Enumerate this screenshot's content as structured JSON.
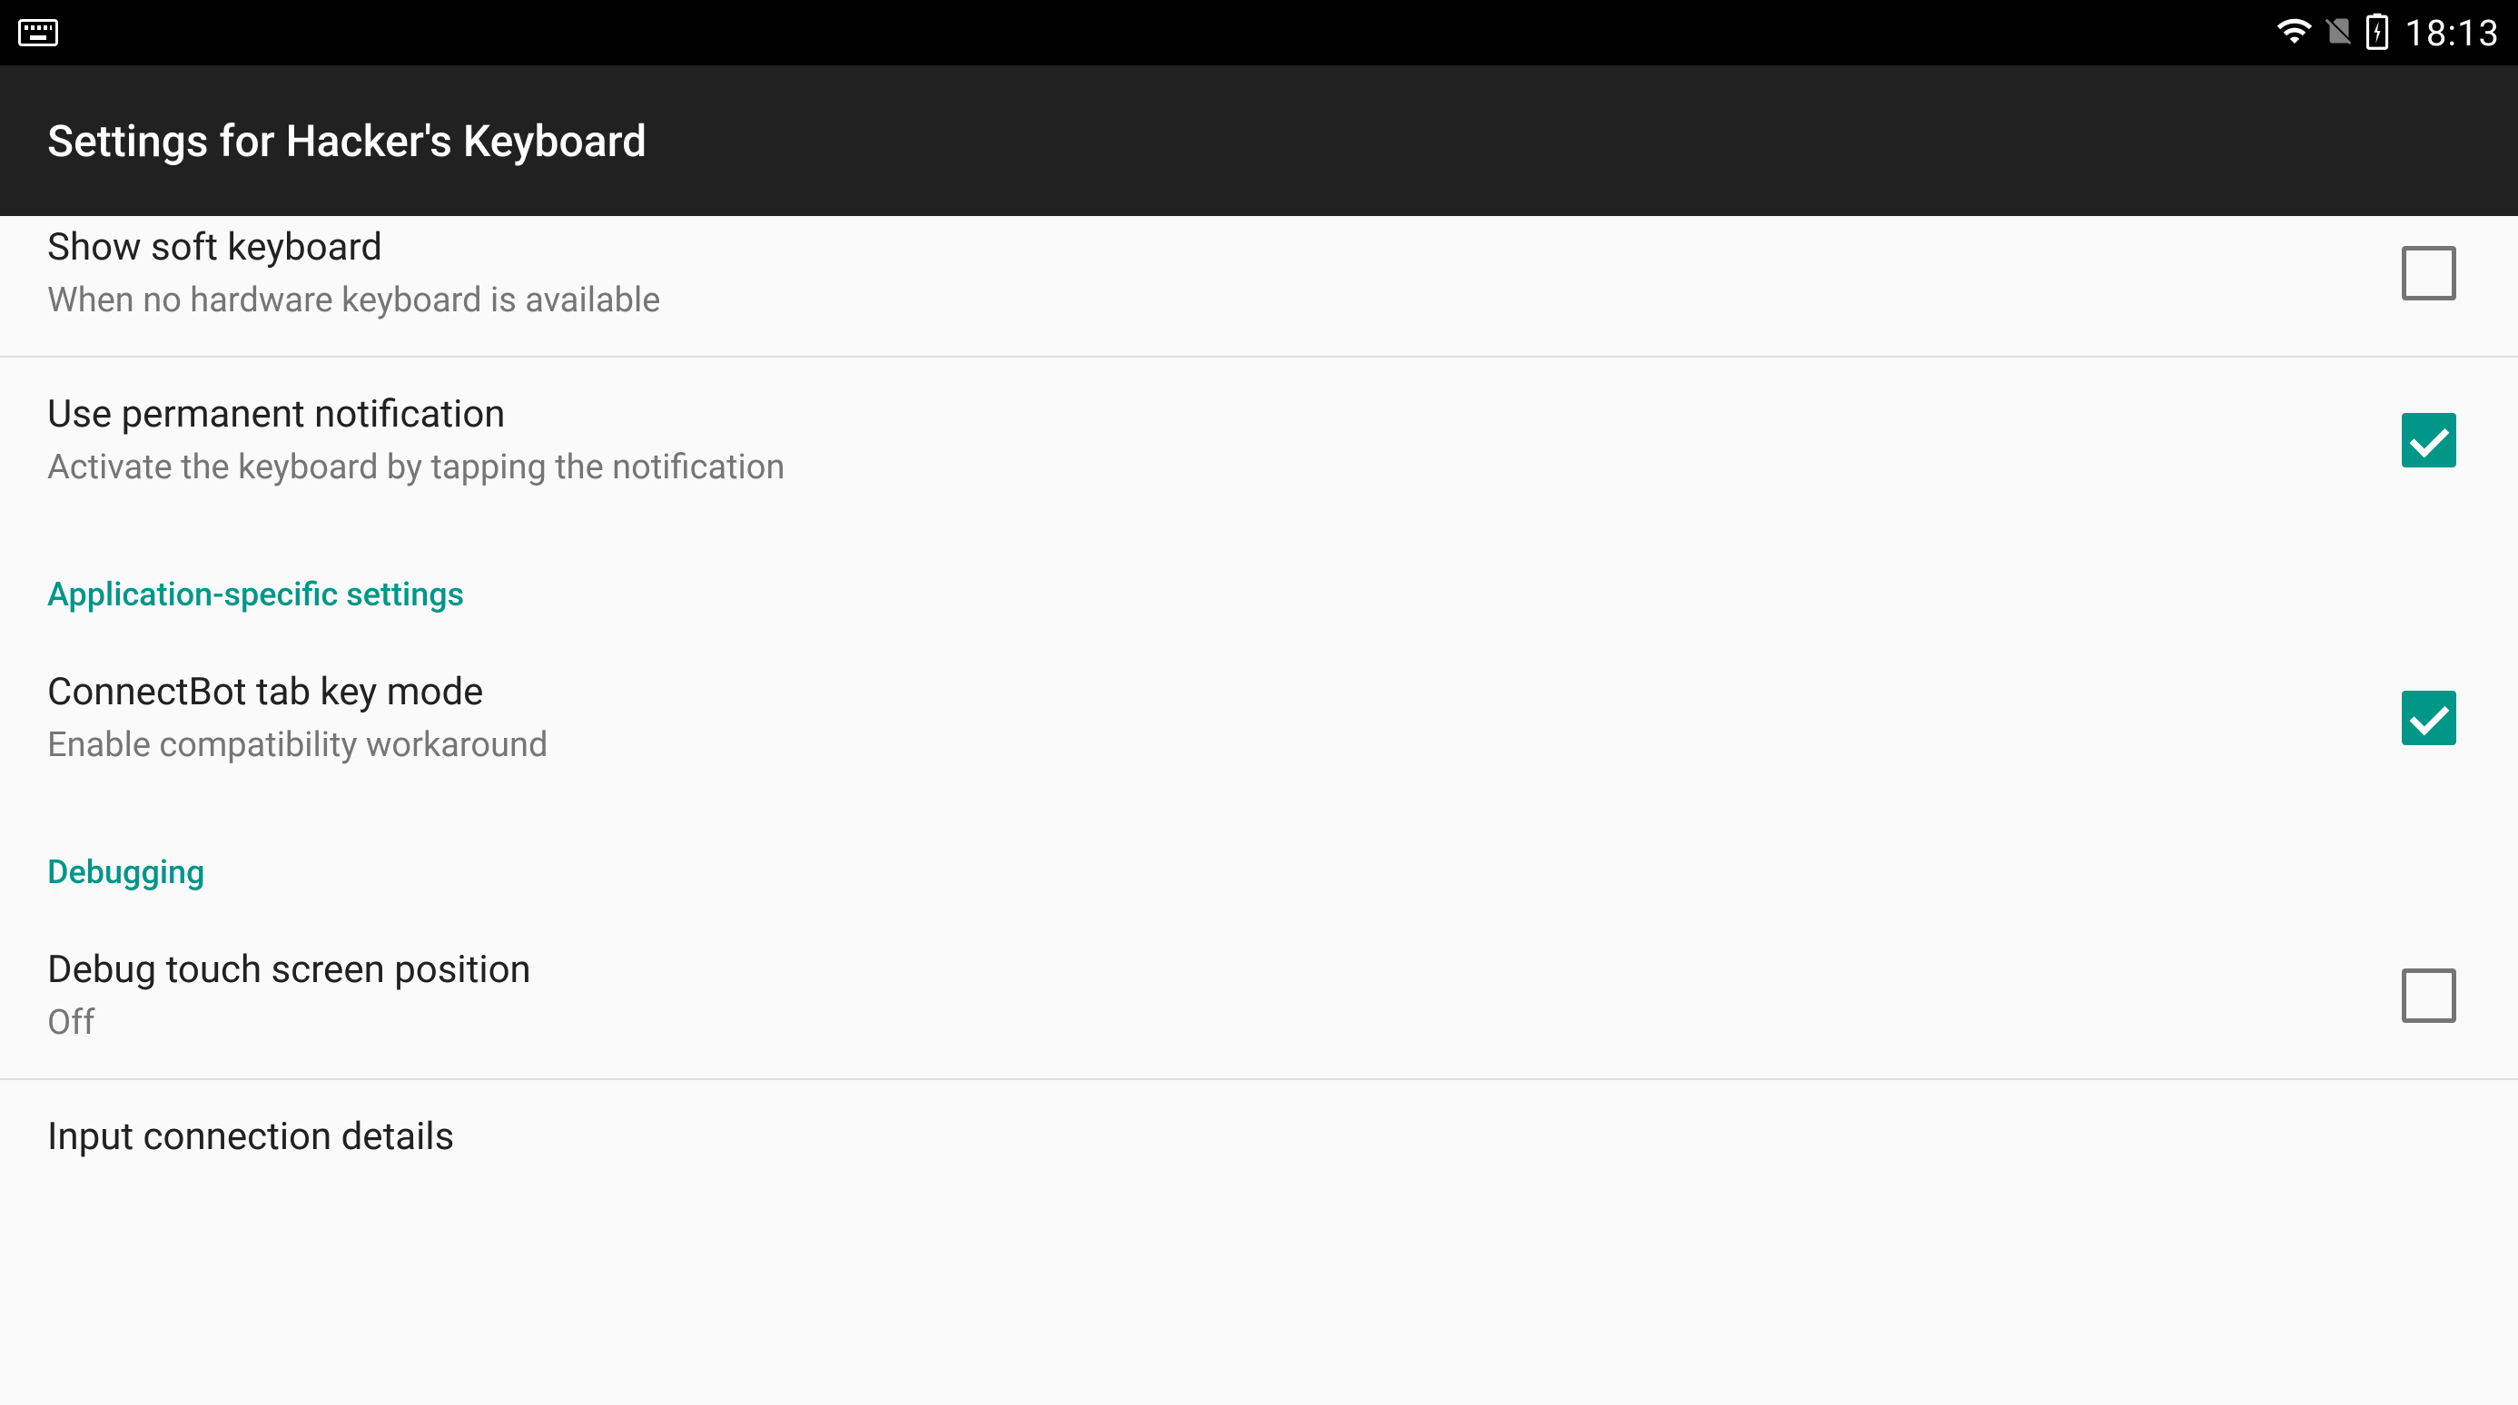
{
  "status_bar": {
    "time": "18:13"
  },
  "app_bar": {
    "title": "Settings for Hacker's Keyboard"
  },
  "settings": {
    "item0": {
      "title": "Show soft keyboard",
      "subtitle": "When no hardware keyboard is available",
      "checked": false
    },
    "item1": {
      "title": "Use permanent notification",
      "subtitle": "Activate the keyboard by tapping the notification",
      "checked": true
    },
    "section1": {
      "title": "Application-specific settings"
    },
    "item2": {
      "title": "ConnectBot tab key mode",
      "subtitle": "Enable compatibility workaround",
      "checked": true
    },
    "section2": {
      "title": "Debugging"
    },
    "item3": {
      "title": "Debug touch screen position",
      "subtitle": "Off",
      "checked": false
    },
    "item4": {
      "title": "Input connection details"
    }
  },
  "colors": {
    "accent": "#009688",
    "status_bg": "#000000",
    "appbar_bg": "#212121",
    "content_bg": "#fafafa"
  }
}
